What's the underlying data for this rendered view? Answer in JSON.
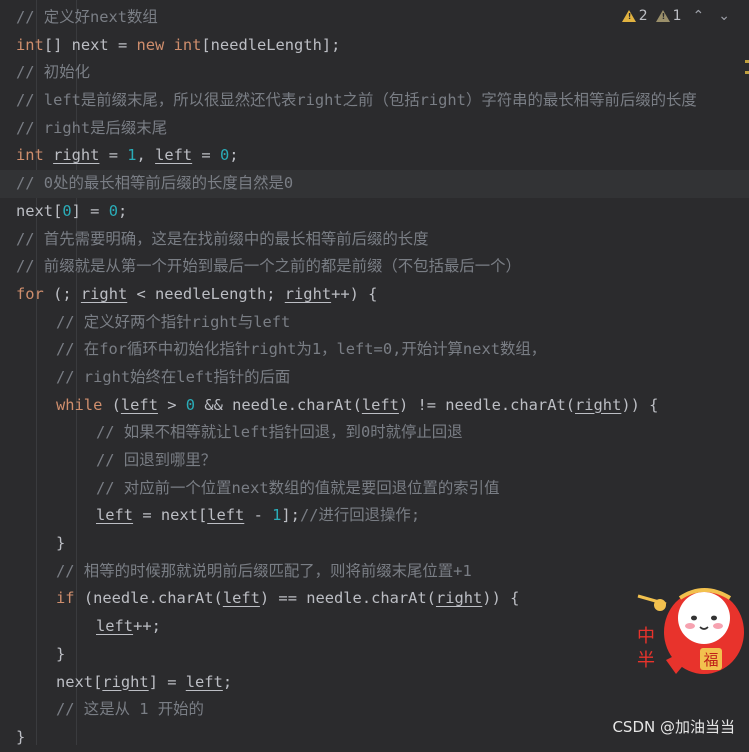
{
  "status_bar": {
    "warnings_count": "2",
    "weak_warnings_count": "1",
    "up_arrow": "⌃",
    "down_arrow": "⌄"
  },
  "code": {
    "l1": "// 定义好next数组",
    "l2_kw": "int",
    "l2_rest": "[] next = ",
    "l2_new": "new",
    "l2_int": "int",
    "l2_tail": "[needleLength];",
    "l3": "// 初始化",
    "l4": "// left是前缀末尾，所以很显然还代表right之前（包括right）字符串的最长相等前后缀的长度",
    "l5": "// right是后缀末尾",
    "l6_kw": "int",
    "l6_right": "right",
    "l6_eq1": " = ",
    "l6_one": "1",
    "l6_comma": ", ",
    "l6_left": "left",
    "l6_eq2": " = ",
    "l6_zero": "0",
    "l6_semi": ";",
    "l7": "// 0处的最长相等前后缀的长度自然是0",
    "l8_a": "next[",
    "l8_zero": "0",
    "l8_b": "] = ",
    "l8_zero2": "0",
    "l8_c": ";",
    "l9": "// 首先需要明确，这是在找前缀中的最长相等前后缀的长度",
    "l10": "// 前缀就是从第一个开始到最后一个之前的都是前缀（不包括最后一个）",
    "l11_kw": "for",
    "l11_a": " (; ",
    "l11_right": "right",
    "l11_b": " < needleLength; ",
    "l11_right2": "right",
    "l11_c": "++) {",
    "l12": "// 定义好两个指针right与left",
    "l13": "// 在for循环中初始化指针right为1，left=0,开始计算next数组，",
    "l14": "// right始终在left指针的后面",
    "l15_kw": "while",
    "l15_a": " (",
    "l15_left": "left",
    "l15_b": " > ",
    "l15_zero": "0",
    "l15_c": " && needle.charAt(",
    "l15_left2": "left",
    "l15_d": ") != needle.charAt(",
    "l15_right": "right",
    "l15_e": ")) {",
    "l16": "// 如果不相等就让left指针回退，到0时就停止回退",
    "l17": "// 回退到哪里？",
    "l18": "// 对应前一个位置next数组的值就是要回退位置的索引值",
    "l19_left": "left",
    "l19_a": " = next[",
    "l19_left2": "left",
    "l19_b": " - ",
    "l19_one": "1",
    "l19_c": "];",
    "l19_cmt": "//进行回退操作;",
    "l20": "}",
    "l21": "// 相等的时候那就说明前后缀匹配了，则将前缀末尾位置+1",
    "l22_kw": "if",
    "l22_a": " (needle.charAt(",
    "l22_left": "left",
    "l22_b": ") == needle.charAt(",
    "l22_right": "right",
    "l22_c": ")) {",
    "l23_left": "left",
    "l23_a": "++;",
    "l24": "}",
    "l25_a": "next[",
    "l25_right": "right",
    "l25_b": "] = ",
    "l25_left": "left",
    "l25_c": ";",
    "l26": "// 这是从 1 开始的",
    "l27": "}"
  },
  "watermark": "CSDN @加油当当",
  "sticker": {
    "char_zhong": "中",
    "char_ban": "半",
    "char_fu": "福"
  },
  "colors": {
    "background": "#2b2b2d",
    "keyword": "#cf8e6d",
    "number": "#2aacb8",
    "comment": "#7a7e85",
    "text": "#bcbec4",
    "warning": "#e2b340"
  }
}
